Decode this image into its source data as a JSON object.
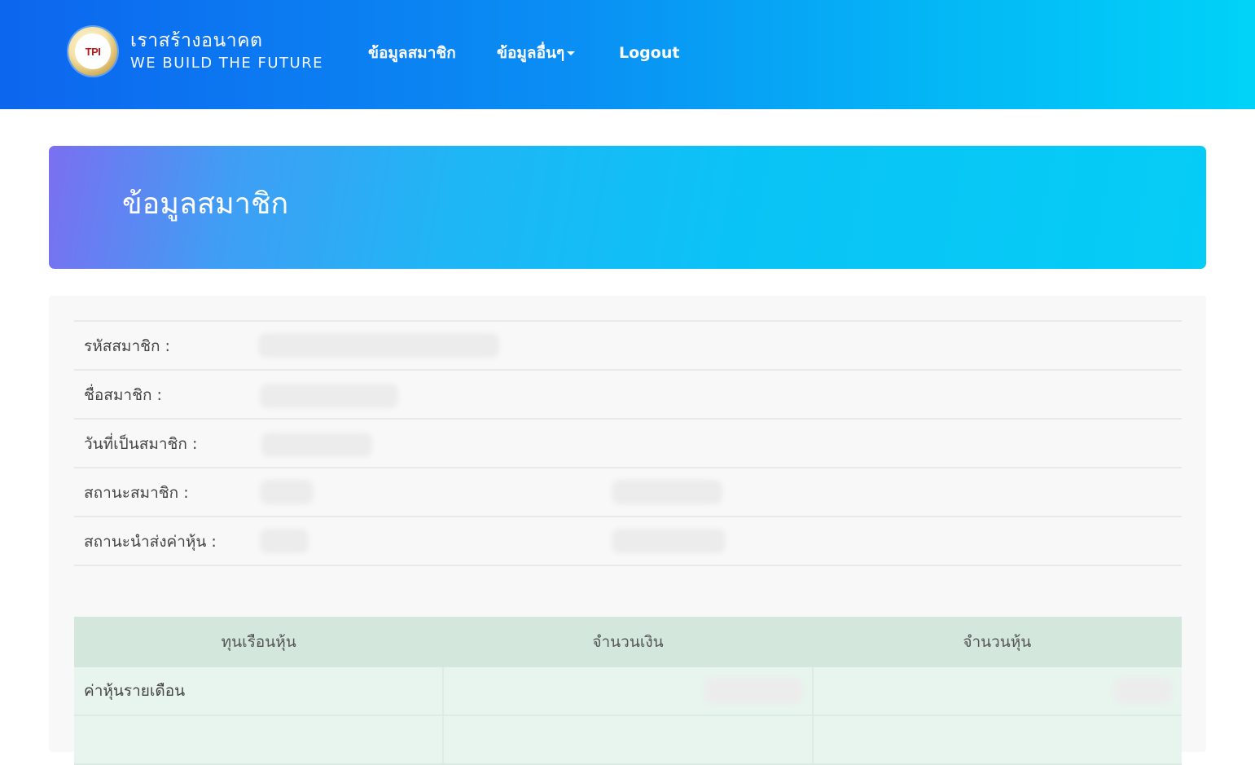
{
  "header": {
    "brand_th": "เราสร้างอนาคต",
    "brand_en": "WE BUILD THE FUTURE",
    "logo_text": "TPI",
    "nav": {
      "member_info": "ข้อมูลสมาชิก",
      "other_info": "ข้อมูลอื่นๆ",
      "logout": "Logout"
    }
  },
  "hero": {
    "title": "ข้อมูลสมาชิก"
  },
  "member_info": {
    "rows": [
      {
        "label": "รหัสสมาชิก :"
      },
      {
        "label": "ชื่อสมาชิก :"
      },
      {
        "label": "วันที่เป็นสมาชิก :"
      },
      {
        "label": "สถานะสมาชิก :"
      },
      {
        "label": "สถานะนำส่งค่าหุ้น :"
      }
    ]
  },
  "shares_table": {
    "headers": [
      "ทุนเรือนหุ้น",
      "จำนวนเงิน",
      "จำนวนหุ้น"
    ],
    "rows": [
      {
        "label": "ค่าหุ้นรายเดือน"
      },
      {
        "label": ""
      }
    ]
  },
  "colors": {
    "navbar_gradient_start": "#0d66ee",
    "navbar_gradient_end": "#00d3f8",
    "hero_gradient_start": "#7b6ff0",
    "hero_gradient_end": "#05cdf6",
    "table_header_bg": "#d3e7dd",
    "table_row_bg": "#e8f4ee"
  },
  "icons": {
    "logo": "tpi-logo",
    "dropdown": "caret-down-icon"
  }
}
